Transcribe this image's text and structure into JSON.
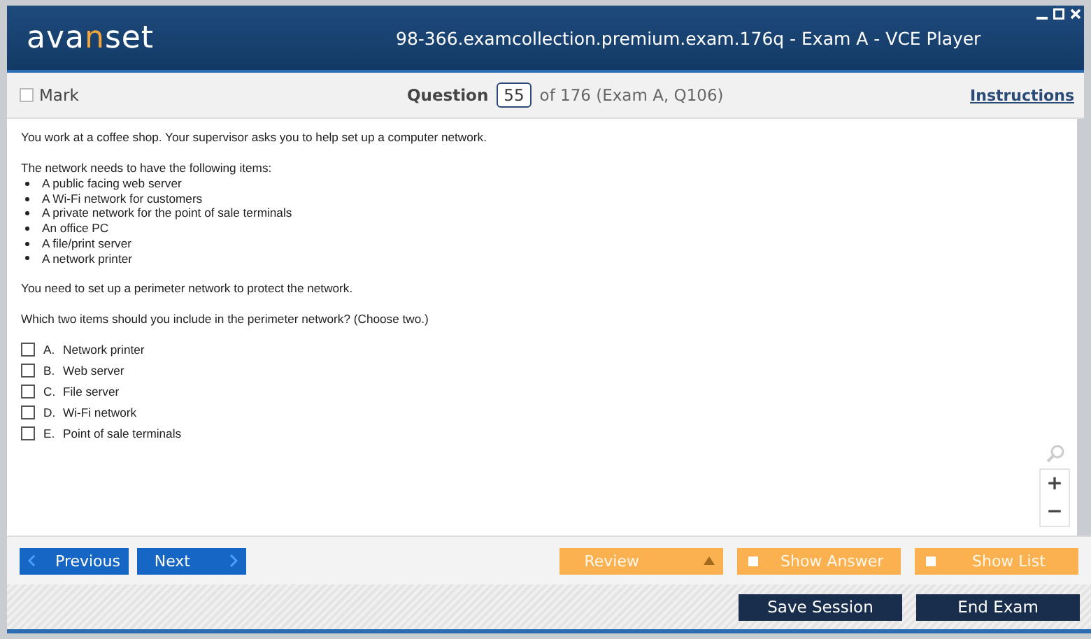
{
  "window": {
    "title": "98-366.examcollection.premium.exam.176q - Exam A - VCE Player"
  },
  "logo": {
    "before": "ava",
    "accent": "n",
    "after": "set"
  },
  "toolbar": {
    "mark": {
      "label": "Mark",
      "checked": false
    },
    "question_label": "Question",
    "question_number": "55",
    "question_of": "of 176 (Exam A, Q106)",
    "instructions": "Instructions"
  },
  "question": {
    "intro": "You work at a coffee shop. Your supervisor asks you to help set up a computer network.",
    "list_heading": "The network needs to have the following items:",
    "items": [
      "A public facing web server",
      "A Wi-Fi network for customers",
      "A private network for the point of sale terminals",
      "An office PC",
      "A file/print server",
      "A network printer"
    ],
    "statement": "You need to set up a perimeter network to protect the network.",
    "prompt": "Which two items should you include in the perimeter network? (Choose two.)",
    "options": [
      {
        "letter": "A.",
        "text": "Network printer",
        "checked": false
      },
      {
        "letter": "B.",
        "text": "Web server",
        "checked": false
      },
      {
        "letter": "C.",
        "text": "File server",
        "checked": false
      },
      {
        "letter": "D.",
        "text": "Wi-Fi network",
        "checked": false
      },
      {
        "letter": "E.",
        "text": "Point of sale terminals",
        "checked": false
      }
    ]
  },
  "zoom": {
    "plus": "+",
    "minus": "−"
  },
  "nav": {
    "previous": "Previous",
    "next": "Next",
    "review": "Review",
    "show_answer": {
      "label": "Show Answer",
      "checked": false
    },
    "show_list": {
      "label": "Show List",
      "checked": false
    }
  },
  "session": {
    "save": "Save Session",
    "end": "End Exam"
  }
}
